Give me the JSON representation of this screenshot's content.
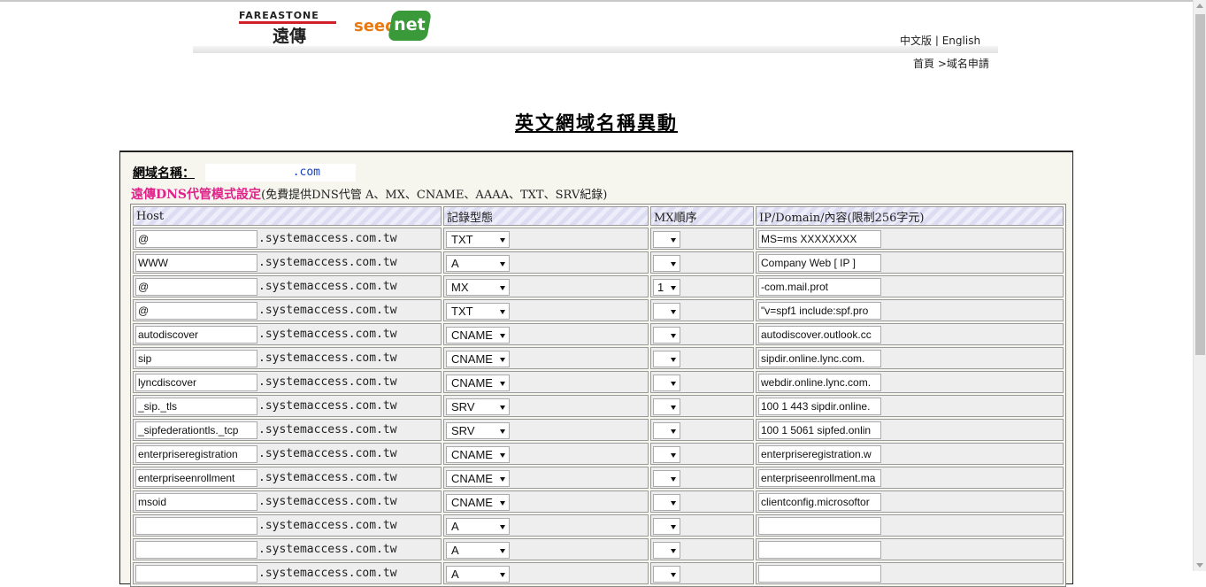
{
  "header": {
    "fe_logo_text": "FAREASTONE",
    "fe_logo_cn": "遠傳",
    "seed_text": "seed",
    "net_text": "net",
    "lang_zh": "中文版",
    "lang_sep": "|",
    "lang_en": "English",
    "breadcrumb_home": "首頁",
    "breadcrumb_sep": ">",
    "breadcrumb_current": "域名申請"
  },
  "page_title": "英文網域名稱異動",
  "domain": {
    "label": "網域名稱",
    "colon": "：",
    "value": ".com"
  },
  "dns": {
    "title": "遠傳DNS代管模式設定",
    "note": "(免費提供DNS代管 A、MX、CNAME、AAAA、TXT、SRV紀錄)",
    "columns": [
      "Host",
      "記錄型態",
      "MX順序",
      "IP/Domain/內容(限制256字元)"
    ],
    "suffix": ".systemaccess.com.tw",
    "rows": [
      {
        "host": "@",
        "type": "TXT",
        "mx": "",
        "content": "MS=ms XXXXXXXX"
      },
      {
        "host": "WWW",
        "type": "A",
        "mx": "",
        "content": "Company Web [ IP ]"
      },
      {
        "host": "@",
        "type": "MX",
        "mx": "1",
        "content": "-com.mail.prot"
      },
      {
        "host": "@",
        "type": "TXT",
        "mx": "",
        "content": "\"v=spf1 include:spf.pro"
      },
      {
        "host": "autodiscover",
        "type": "CNAME",
        "mx": "",
        "content": "autodiscover.outlook.cc"
      },
      {
        "host": "sip",
        "type": "CNAME",
        "mx": "",
        "content": "sipdir.online.lync.com."
      },
      {
        "host": "lyncdiscover",
        "type": "CNAME",
        "mx": "",
        "content": "webdir.online.lync.com."
      },
      {
        "host": "_sip._tls",
        "type": "SRV",
        "mx": "",
        "content": "100 1 443 sipdir.online."
      },
      {
        "host": "_sipfederationtls._tcp",
        "type": "SRV",
        "mx": "",
        "content": "100 1 5061 sipfed.onlin"
      },
      {
        "host": "enterpriseregistration",
        "type": "CNAME",
        "mx": "",
        "content": "enterpriseregistration.w"
      },
      {
        "host": "enterpriseenrollment",
        "type": "CNAME",
        "mx": "",
        "content": "enterpriseenrollment.ma"
      },
      {
        "host": "msoid",
        "type": "CNAME",
        "mx": "",
        "content": "clientconfig.microsoftor"
      },
      {
        "host": "",
        "type": "A",
        "mx": "",
        "content": ""
      },
      {
        "host": "",
        "type": "A",
        "mx": "",
        "content": ""
      },
      {
        "host": "",
        "type": "A",
        "mx": "",
        "content": ""
      }
    ]
  },
  "colors": {
    "accent_pink": "#e0218a",
    "domain_blue": "#1a3fbf"
  }
}
